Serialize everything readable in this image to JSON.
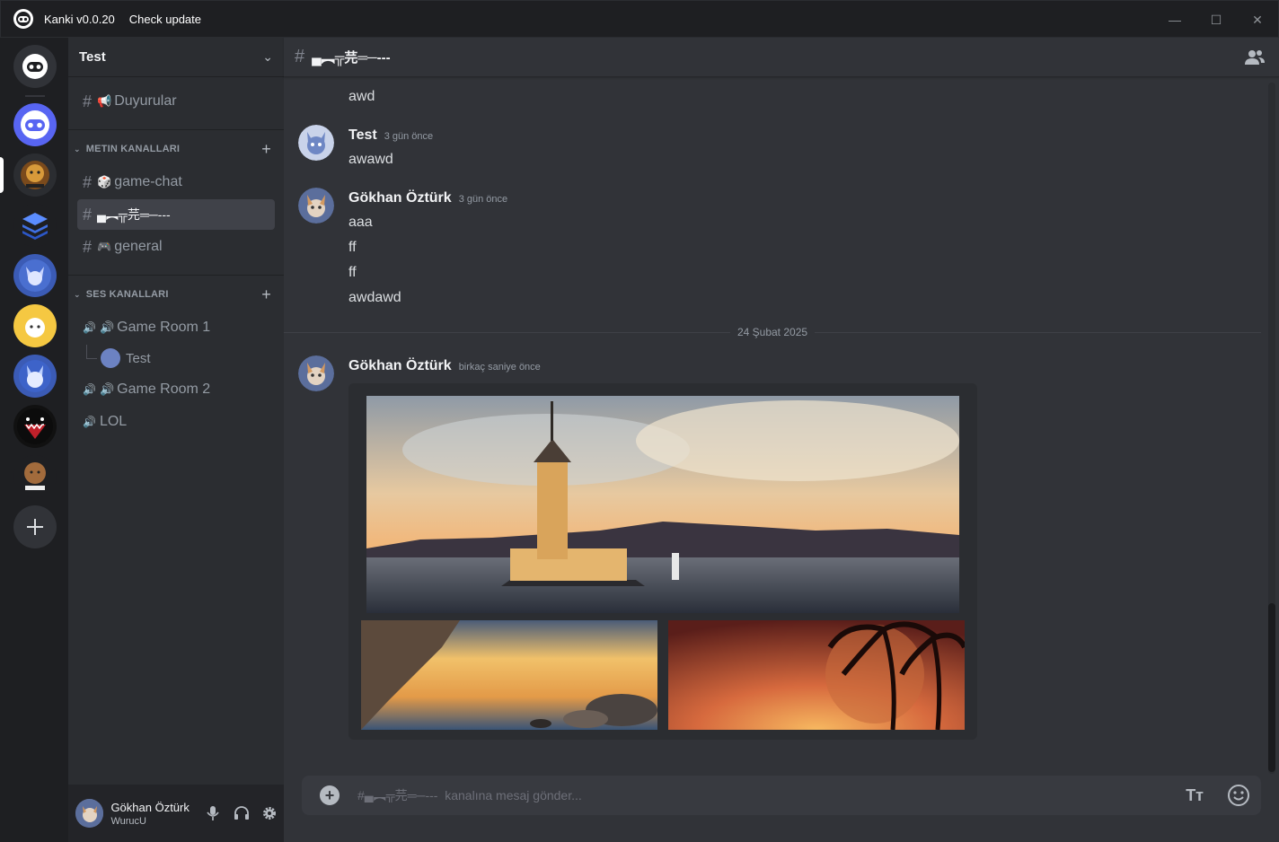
{
  "titlebar": {
    "app_title": "Kanki v0.0.20",
    "check_update": "Check update",
    "minimize": "—",
    "maximize": "☐",
    "close": "✕"
  },
  "guild": {
    "name": "Test"
  },
  "channels": {
    "announcements": {
      "icon": "📢",
      "label": "Duyurular"
    },
    "text_category": "METIN KANALLARI",
    "text": [
      {
        "icon": "🎲",
        "label": "game-chat"
      },
      {
        "icon": "",
        "label": "▄︻╦芫═─---"
      },
      {
        "icon": "🎮",
        "label": "general"
      }
    ],
    "voice_category": "SES KANALLARI",
    "voice": [
      {
        "icon": "🔊",
        "label": "Game Room 1"
      },
      {
        "icon": "🔊",
        "label": "Game Room 2"
      },
      {
        "icon": "",
        "label": "LOL"
      }
    ],
    "voice_user": "Test"
  },
  "user_panel": {
    "display_name": "Gökhan Öztürk",
    "tag": "WurucU"
  },
  "chat": {
    "channel_name": "▄︻╦芫═─---",
    "messages": [
      {
        "author": "",
        "time": "",
        "lines": [
          "awd"
        ]
      },
      {
        "author": "Test",
        "time": "3 gün önce",
        "lines": [
          "awawd"
        ]
      },
      {
        "author": "Gökhan Öztürk",
        "time": "3 gün önce",
        "lines": [
          "aaa",
          "ff",
          "ff",
          "awdawd"
        ]
      }
    ],
    "date_divider": "24 Şubat 2025",
    "last_message": {
      "author": "Gökhan Öztürk",
      "time": "birkaç saniye önce"
    }
  },
  "composer": {
    "placeholder": "#▄︻╦芫═─---  kanalına mesaj gönder...",
    "format_label": "Tт"
  },
  "colors": {
    "accent": "#5865f2",
    "background": "#313338",
    "sidebar": "#2b2d31",
    "rail": "#1e1f22"
  }
}
